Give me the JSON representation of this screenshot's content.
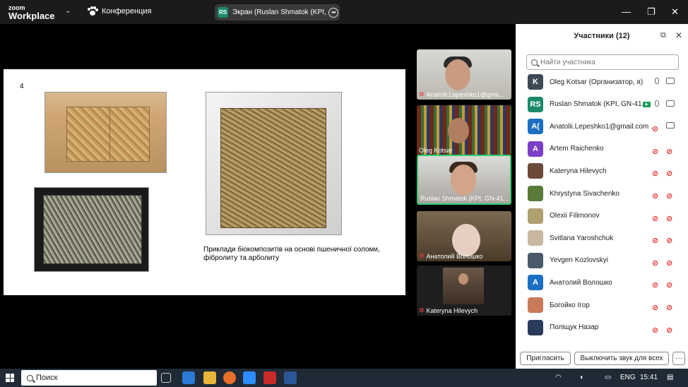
{
  "titlebar": {
    "logo_line1": "zoom",
    "logo_line2": "Workplace",
    "conference_label": "Конференция",
    "screen_chip": "RS",
    "screen_label": "Экран (Ruslan Shmatok (KPI, GN",
    "minimize": "—",
    "restore": "❐",
    "close": "✕"
  },
  "slide": {
    "number": "4",
    "caption": "Приклади біокомпозитів на основі пшеничної соломи, фібролиту та арболиту"
  },
  "video_tiles": [
    {
      "name": "Anatolii.Lepeshko1@gma...",
      "muted": true
    },
    {
      "name": "Oleg Kotsar",
      "muted": false
    },
    {
      "name": "Ruslan Shmatok (KPI, GN-41...",
      "muted": false,
      "active": true
    },
    {
      "name": "Анатолий Волошко",
      "muted": true
    },
    {
      "name": "Kateryna Hilevych",
      "muted": true
    }
  ],
  "participants_panel": {
    "title": "Участники (12)",
    "search_placeholder": "Найти участника",
    "participants": [
      {
        "initials": "K",
        "name": "Oleg Kotsar (Организатор, я)",
        "color": "#3d4a55",
        "mic": "on",
        "cam": "on",
        "sharing": false
      },
      {
        "initials": "RS",
        "name": "Ruslan Shmatok (KPI, GN-41...",
        "color": "#1b8a6b",
        "mic": "on",
        "cam": "on",
        "sharing": true
      },
      {
        "initials": "A(",
        "name": "Anatolii.Lepeshko1@gmail.com ...",
        "color": "#1b6fc2",
        "mic": "off",
        "cam": "on",
        "sharing": false
      },
      {
        "initials": "A",
        "name": "Artem Raichenko",
        "color": "#7b3fc6",
        "mic": "off",
        "cam": "off",
        "sharing": false
      },
      {
        "initials": "",
        "name": "Kateryna Hilevych",
        "color": "#6b4a3a",
        "mic": "off",
        "cam": "off",
        "sharing": false
      },
      {
        "initials": "",
        "name": "Khrystyna Sivachenko",
        "color": "#5a7a3a",
        "mic": "off",
        "cam": "off",
        "sharing": false
      },
      {
        "initials": "",
        "name": "Olexii Filimonov",
        "color": "#b0a070",
        "mic": "off",
        "cam": "off",
        "sharing": false
      },
      {
        "initials": "",
        "name": "Svitlana Yaroshchuk",
        "color": "#c9b8a0",
        "mic": "off",
        "cam": "off",
        "sharing": false
      },
      {
        "initials": "",
        "name": "Yevgen Kozlovskyi",
        "color": "#4a5a6a",
        "mic": "off",
        "cam": "off",
        "sharing": false
      },
      {
        "initials": "A",
        "name": "Анатолий Волошко",
        "color": "#1b6fc2",
        "mic": "off",
        "cam": "off",
        "sharing": false
      },
      {
        "initials": "",
        "name": "Богойко Ігор",
        "color": "#c97a5a",
        "mic": "off",
        "cam": "off",
        "sharing": false
      },
      {
        "initials": "",
        "name": "Поліщук Назар",
        "color": "#2a3a5a",
        "mic": "off",
        "cam": "off",
        "sharing": false
      }
    ],
    "invite_button": "Пригласить",
    "mute_all_button": "Выключить звук для всех",
    "more_button": "···"
  },
  "taskbar": {
    "search_label": "Поиск",
    "language": "ENG",
    "time": "15:41"
  }
}
